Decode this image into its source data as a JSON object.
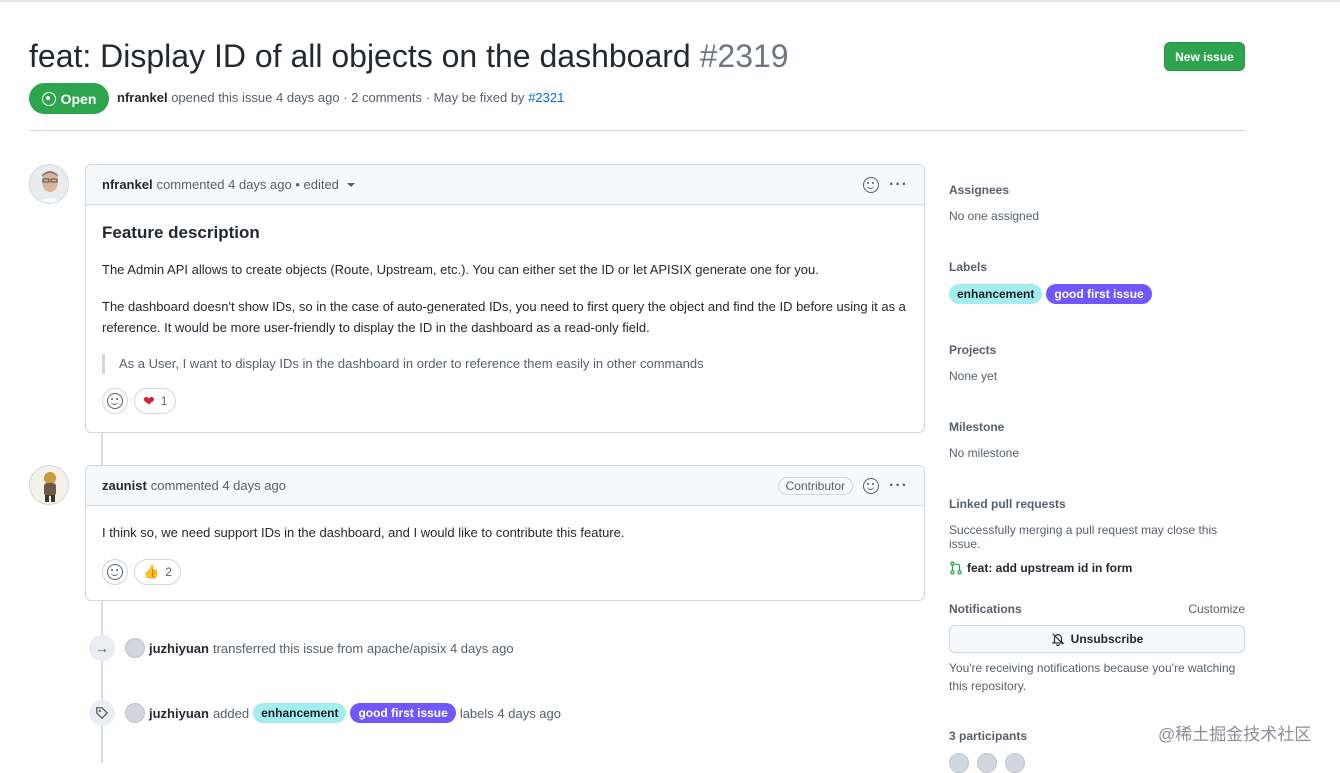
{
  "issue": {
    "title": "feat: Display ID of all objects on the dashboard",
    "number": "#2319",
    "new_issue_label": "New issue",
    "state": "Open",
    "meta_author": "nfrankel",
    "meta_text": "opened this issue 4 days ago · 2 comments · May be fixed by",
    "meta_link": "#2321"
  },
  "comments": [
    {
      "author": "nfrankel",
      "meta": "commented 4 days ago • edited",
      "heading": "Feature description",
      "paragraphs": [
        "The Admin API allows to create objects (Route, Upstream, etc.). You can either set the ID or let APISIX generate one for you.",
        "The dashboard doesn't show IDs, so in the case of auto-generated IDs, you need to first query the object and find the ID before using it as a reference. It would be more user-friendly to display the ID in the dashboard as a read-only field."
      ],
      "quote": "As a User, I want to display IDs in the dashboard in order to reference them easily in other commands",
      "reaction": {
        "icon": "heart-icon",
        "count": "1"
      }
    },
    {
      "author": "zaunist",
      "meta": "commented 4 days ago",
      "badge": "Contributor",
      "paragraphs": [
        "I think so, we need support IDs in the dashboard, and I would like to contribute this feature."
      ],
      "reaction": {
        "icon": "thumbs-up-icon",
        "count": "2"
      }
    }
  ],
  "events": [
    {
      "actor": "juzhiyuan",
      "text": "transferred this issue from apache/apisix 4 days ago",
      "icon": "arrow-right-icon"
    },
    {
      "actor": "juzhiyuan",
      "pre": "added",
      "labels": [
        "enhancement",
        "good first issue"
      ],
      "post": "labels 4 days ago",
      "icon": "tag-icon"
    }
  ],
  "sidebar": {
    "assignees": {
      "title": "Assignees",
      "value": "No one assigned"
    },
    "labels": {
      "title": "Labels",
      "items": [
        "enhancement",
        "good first issue"
      ]
    },
    "projects": {
      "title": "Projects",
      "value": "None yet"
    },
    "milestone": {
      "title": "Milestone",
      "value": "No milestone"
    },
    "linked_prs": {
      "title": "Linked pull requests",
      "desc": "Successfully merging a pull request may close this issue.",
      "pr": "feat: add upstream id in form"
    },
    "notifications": {
      "title": "Notifications",
      "customize": "Customize",
      "button": "Unsubscribe",
      "desc": "You're receiving notifications because you're watching this repository."
    },
    "participants": {
      "title": "3 participants"
    }
  },
  "colors": {
    "open_green": "#2da44e",
    "enhancement": "#a2eeef",
    "good_first_issue": "#7057ff",
    "link": "#0969da"
  },
  "watermark": "@稀土掘金技术社区"
}
